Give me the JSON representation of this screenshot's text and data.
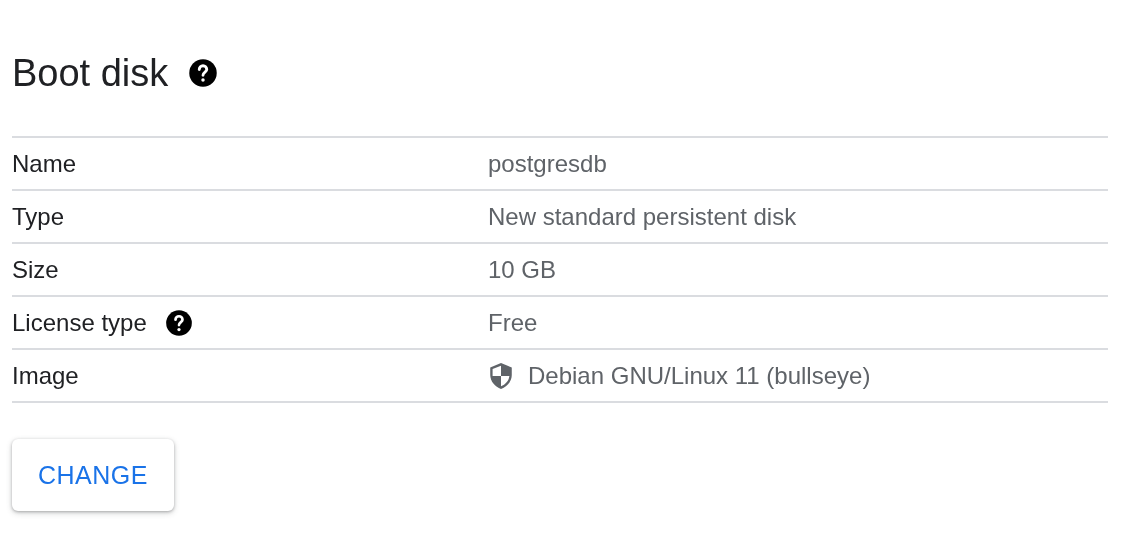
{
  "title": "Boot disk",
  "title_help": true,
  "rows": [
    {
      "label": "Name",
      "help": false,
      "kind": "text",
      "value": "postgresdb"
    },
    {
      "label": "Type",
      "help": false,
      "kind": "text",
      "value": "New standard persistent disk"
    },
    {
      "label": "Size",
      "help": false,
      "kind": "text",
      "value": "10 GB"
    },
    {
      "label": "License type",
      "help": true,
      "kind": "text",
      "value": "Free"
    },
    {
      "label": "Image",
      "help": false,
      "kind": "shield",
      "value": "Debian GNU/Linux 11 (bullseye)"
    }
  ],
  "button": "CHANGE"
}
